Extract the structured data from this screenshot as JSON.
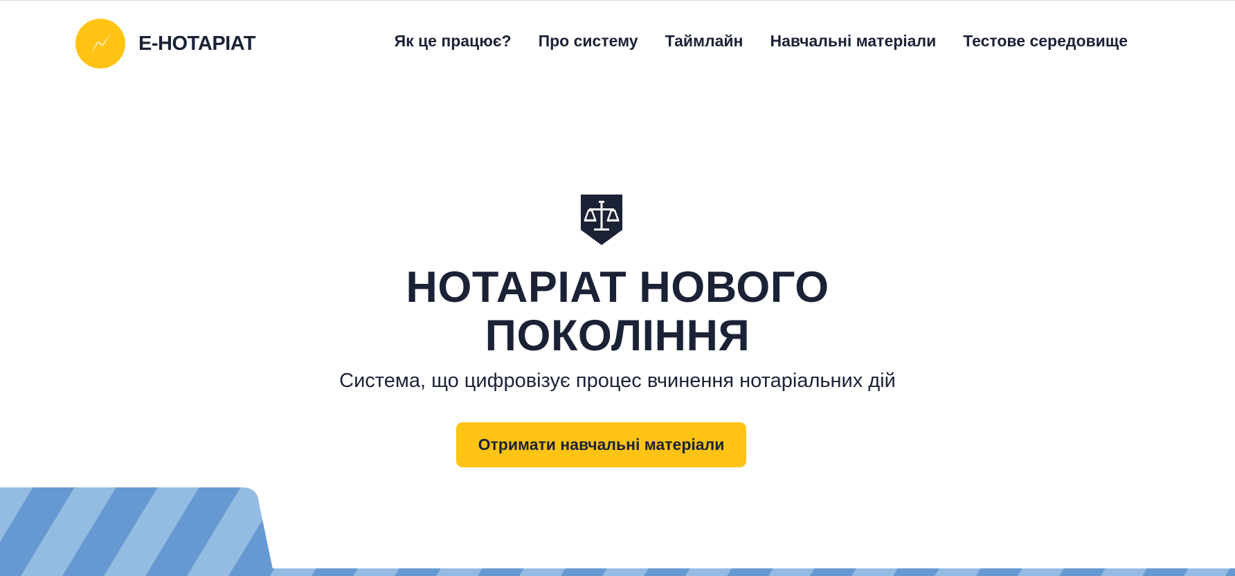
{
  "header": {
    "logo_text": "Е-НОТАРІАТ",
    "logo_icon": "e-notariat-logo-icon",
    "nav": [
      {
        "label": "Як це працює?"
      },
      {
        "label": "Про систему"
      },
      {
        "label": "Таймлайн"
      },
      {
        "label": "Навчальні матеріали"
      },
      {
        "label": "Тестове середовище"
      }
    ]
  },
  "hero": {
    "emblem_icon": "scales-shield-icon",
    "title_line1": "НОТАРІАТ НОВОГО",
    "title_line2": "ПОКОЛІННЯ",
    "subtitle": "Система, що цифровізує процес вчинення нотаріальних дій",
    "cta_label": "Отримати навчальні матеріали"
  },
  "colors": {
    "accent_yellow": "#ffc313",
    "text_dark": "#1b2236",
    "stripe_light": "#94bce3",
    "stripe_dark": "#6699d1"
  }
}
